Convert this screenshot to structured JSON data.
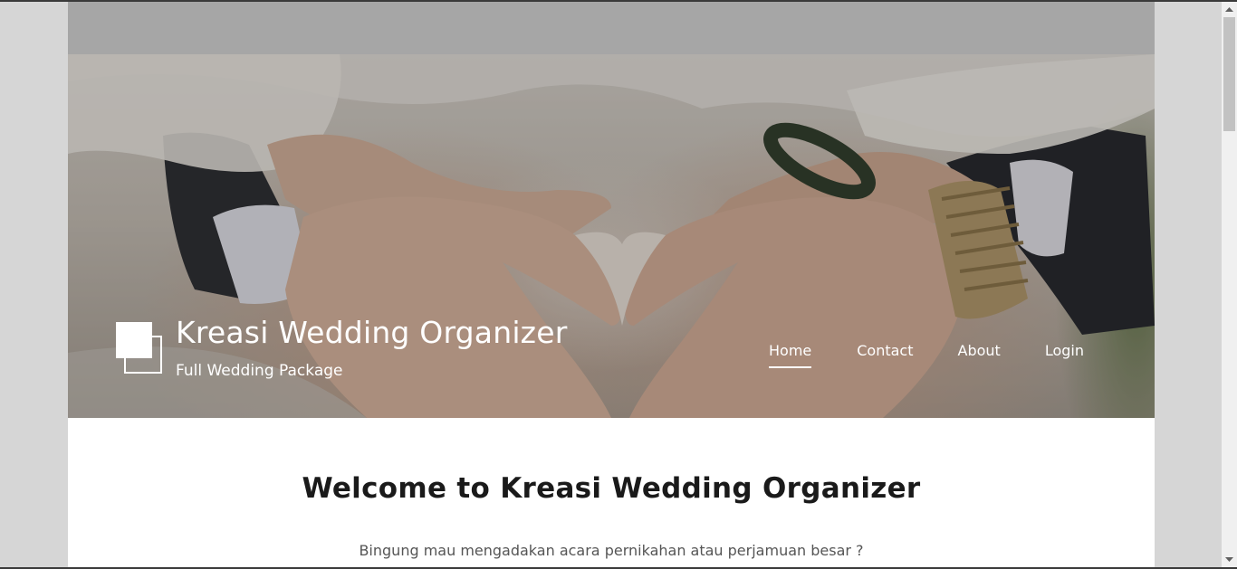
{
  "header": {
    "site_title": "Kreasi Wedding Organizer",
    "tagline": "Full Wedding Package"
  },
  "nav": {
    "items": [
      {
        "label": "Home",
        "active": true
      },
      {
        "label": "Contact",
        "active": false
      },
      {
        "label": "About",
        "active": false
      },
      {
        "label": "Login",
        "active": false
      }
    ]
  },
  "main": {
    "welcome_heading": "Welcome to Kreasi Wedding Organizer",
    "intro_text": "Bingung mau mengadakan acara pernikahan atau perjamuan besar ?"
  },
  "icons": {
    "logo": "logo-squares-icon",
    "scroll_up": "scroll-up-arrow-icon",
    "scroll_down": "scroll-down-arrow-icon"
  },
  "colors": {
    "page_background": "#d6d6d6",
    "content_background": "#ffffff",
    "topbar": "#a6a6a6",
    "hero_text": "#ffffff",
    "heading_text": "#1a1a1a",
    "body_text": "#555555"
  }
}
